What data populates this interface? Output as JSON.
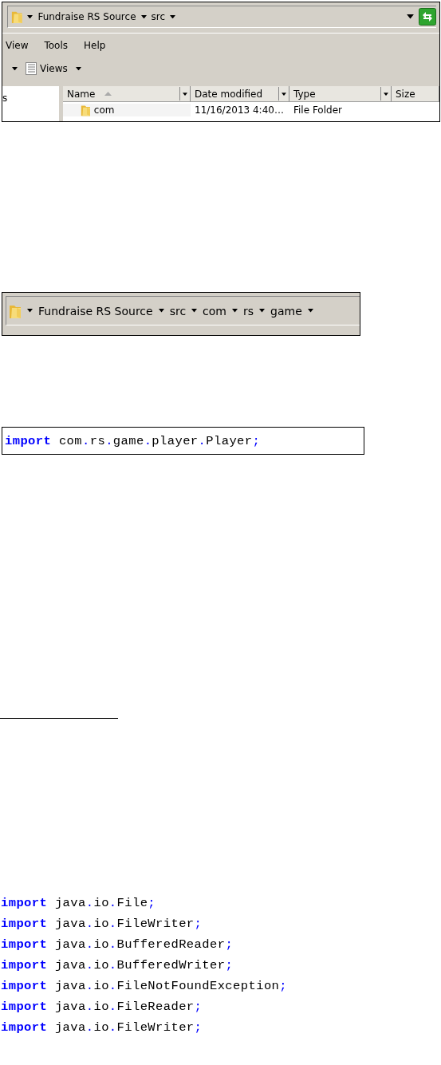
{
  "explorer": {
    "address_crumbs": [
      "Fundraise RS Source",
      "src"
    ],
    "menu": [
      "View",
      "Tools",
      "Help"
    ],
    "toolbar": {
      "views_label": "Views"
    },
    "left_pane_text": "s",
    "columns": [
      {
        "label": "Name",
        "sorted": true
      },
      {
        "label": "Date modified",
        "sorted": false
      },
      {
        "label": "Type",
        "sorted": false
      },
      {
        "label": "Size",
        "sorted": false
      }
    ],
    "rows": [
      {
        "name": "com",
        "date": "11/16/2013 4:40…",
        "type": "File Folder"
      }
    ]
  },
  "breadcrumb": {
    "crumbs": [
      "Fundraise RS Source",
      "src",
      "com",
      "rs",
      "game"
    ]
  },
  "import_snippet": {
    "keyword": "import",
    "code": "com.rs.game.player.Player;"
  },
  "imports": [
    {
      "keyword": "import",
      "code": "java.io.File;"
    },
    {
      "keyword": "import",
      "code": "java.io.FileWriter;"
    },
    {
      "keyword": "import",
      "code": "java.io.BufferedReader;"
    },
    {
      "keyword": "import",
      "code": "java.io.BufferedWriter;"
    },
    {
      "keyword": "import",
      "code": "java.io.FileNotFoundException;"
    },
    {
      "keyword": "import",
      "code": "java.io.FileReader;"
    },
    {
      "keyword": "import",
      "code": "java.io.FileWriter;"
    }
  ]
}
